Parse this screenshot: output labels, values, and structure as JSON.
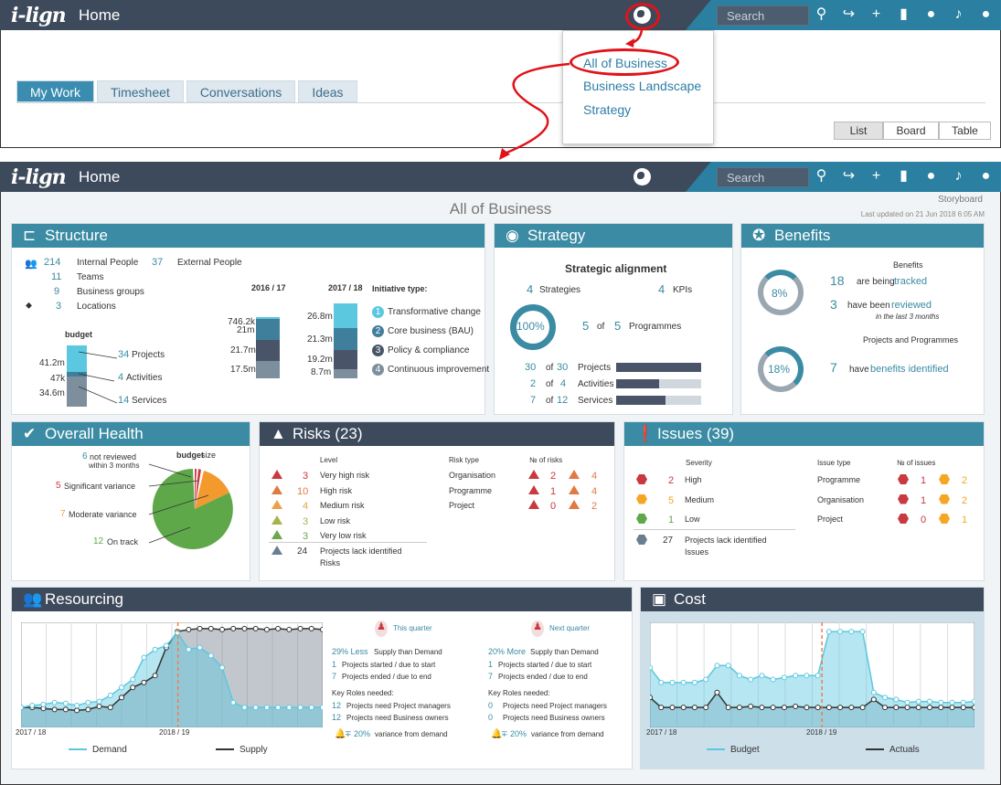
{
  "app": {
    "logo": "i-lign",
    "home": "Home",
    "search_placeholder": "Search"
  },
  "top": {
    "tabs": [
      {
        "label": "My Work",
        "active": true
      },
      {
        "label": "Timesheet"
      },
      {
        "label": "Conversations"
      },
      {
        "label": "Ideas"
      }
    ],
    "views": [
      "List",
      "Board",
      "Table"
    ],
    "dropdown": [
      "All of Business",
      "Business Landscape",
      "Strategy"
    ]
  },
  "page": {
    "title": "All of Business",
    "storyboard": "Storyboard",
    "updated": "Last updated on 21 Jun 2018 6:05 AM"
  },
  "structure": {
    "title": "Structure",
    "rows": [
      {
        "n": "214",
        "label": "Internal People",
        "n2": "37",
        "label2": "External People"
      },
      {
        "n": "11",
        "label": "Teams"
      },
      {
        "n": "9",
        "label": "Business groups"
      },
      {
        "n": "3",
        "label": "Locations"
      }
    ],
    "budget_label": "budget",
    "budget": [
      {
        "v": "41.2m",
        "n": "34",
        "label": "Projects"
      },
      {
        "v": "47k",
        "n": "4",
        "label": "Activities"
      },
      {
        "v": "34.6m",
        "n": "14",
        "label": "Services"
      }
    ],
    "year1": "2016 / 17",
    "year2": "2017 / 18",
    "y1vals": [
      "746.2k",
      "21m",
      "21.7m",
      "17.5m"
    ],
    "y2vals": [
      "26.8m",
      "21.3m",
      "19.2m",
      "8.7m"
    ],
    "init_title": "Initiative type:",
    "init": [
      {
        "n": "1",
        "label": "Transformative change",
        "color": "#5bc8df"
      },
      {
        "n": "2",
        "label": "Core business (BAU)",
        "color": "#3f7f9c"
      },
      {
        "n": "3",
        "label": "Policy & compliance",
        "color": "#4a5468"
      },
      {
        "n": "4",
        "label": "Continuous improvement",
        "color": "#7d8f9c"
      }
    ]
  },
  "strategy": {
    "title": "Strategy",
    "subtitle": "Strategic alignment",
    "strategies_n": "4",
    "strategies": "Strategies",
    "kpis_n": "4",
    "kpis": "KPIs",
    "pct": "100%",
    "prog_a": "5",
    "of": "of",
    "prog_b": "5",
    "programmes": "Programmes",
    "rows": [
      {
        "a": "30",
        "b": "30",
        "label": "Projects",
        "frac": 1.0
      },
      {
        "a": "2",
        "b": "4",
        "label": "Activities",
        "frac": 0.5
      },
      {
        "a": "7",
        "b": "12",
        "label": "Services",
        "frac": 0.58
      }
    ]
  },
  "benefits": {
    "title": "Benefits",
    "head1": "Benefits",
    "pct1": "8%",
    "n1": "18",
    "t1a": "are being",
    "t1b": "tracked",
    "n2": "3",
    "t2a": "have been",
    "t2b": "reviewed",
    "t2c": "in the last 3 months",
    "head2": "Projects and Programmes",
    "pct2": "18%",
    "n3": "7",
    "t3a": "have",
    "t3b": "benefits identified"
  },
  "health": {
    "title": "Overall Health",
    "size_a": "budget",
    "size_b": "size",
    "labels": [
      {
        "n": "6",
        "t": "not reviewed",
        "t2": "within 3 months"
      },
      {
        "n": "5",
        "t": "Significant variance"
      },
      {
        "n": "7",
        "t": "Moderate variance"
      },
      {
        "n": "12",
        "t": "On track"
      }
    ]
  },
  "risks": {
    "title": "Risks (23)",
    "level": "Level",
    "type": "Risk type",
    "count": "№ of risks",
    "levels": [
      {
        "n": "3",
        "t": "Very high risk",
        "c": "#c9393f"
      },
      {
        "n": "10",
        "t": "High risk",
        "c": "#e07a45"
      },
      {
        "n": "4",
        "t": "Medium risk",
        "c": "#e9a24a"
      },
      {
        "n": "3",
        "t": "Low risk",
        "c": "#a9b34b"
      },
      {
        "n": "3",
        "t": "Very low risk",
        "c": "#6aa84f"
      }
    ],
    "lack_n": "24",
    "lack": "Projects lack identified",
    "lack2": "Risks",
    "types": [
      {
        "t": "Organisation",
        "a": "2",
        "b": "4"
      },
      {
        "t": "Programme",
        "a": "1",
        "b": "4"
      },
      {
        "t": "Project",
        "a": "0",
        "b": "2"
      }
    ]
  },
  "issues": {
    "title": "Issues (39)",
    "severity": "Severity",
    "type": "Issue type",
    "count": "№ of issues",
    "levels": [
      {
        "n": "2",
        "t": "High",
        "c": "#c9393f"
      },
      {
        "n": "5",
        "t": "Medium",
        "c": "#f5a623"
      },
      {
        "n": "1",
        "t": "Low",
        "c": "#5fa84a"
      }
    ],
    "lack_n": "27",
    "lack": "Projects lack identified",
    "lack2": "Issues",
    "types": [
      {
        "t": "Programme",
        "a": "1",
        "b": "2"
      },
      {
        "t": "Organisation",
        "a": "1",
        "b": "2"
      },
      {
        "t": "Project",
        "a": "0",
        "b": "1"
      }
    ]
  },
  "resourcing": {
    "title": "Resourcing",
    "x1": "2017 / 18",
    "x2": "2018 / 19",
    "legend1": "Demand",
    "legend2": "Supply",
    "q1": {
      "title": "This quarter",
      "pct": "29% Less",
      "supply": "Supply than Demand",
      "a": "1",
      "at": "Projects started / due to start",
      "b": "7",
      "bt": "Projects ended / due to end",
      "roles": "Key Roles needed:",
      "c": "12",
      "ct": "Projects need Project managers",
      "d": "12",
      "dt": "Projects need Business owners",
      "v": "∓ 20%",
      "vt": "variance from demand"
    },
    "q2": {
      "title": "Next quarter",
      "pct": "20% More",
      "supply": "Supply than Demand",
      "a": "1",
      "at": "Projects started / due to start",
      "b": "7",
      "bt": "Projects ended / due to end",
      "roles": "Key Roles needed:",
      "c": "0",
      "ct": "Projects need Project managers",
      "d": "0",
      "dt": "Projects need Business owners",
      "v": "∓ 20%",
      "vt": "variance from demand"
    },
    "chart_data": {
      "type": "area",
      "series": [
        {
          "name": "Demand",
          "values": [
            20,
            22,
            23,
            25,
            24,
            22,
            25,
            26,
            32,
            40,
            48,
            70,
            78,
            82,
            95,
            78,
            80,
            72,
            60,
            25,
            20,
            20,
            20,
            20,
            20,
            20,
            20,
            20
          ]
        },
        {
          "name": "Supply",
          "values": [
            20,
            20,
            19,
            18,
            18,
            17,
            18,
            21,
            20,
            30,
            40,
            45,
            52,
            80,
            96,
            98,
            99,
            99,
            98,
            99,
            99,
            99,
            98,
            99,
            98,
            99,
            99,
            98
          ]
        }
      ],
      "ylim": [
        0,
        100
      ]
    }
  },
  "cost": {
    "title": "Cost",
    "x1": "2017 / 18",
    "x2": "2018 / 19",
    "legend1": "Budget",
    "legend2": "Actuals",
    "chart_data": {
      "type": "area",
      "series": [
        {
          "name": "Budget",
          "values": [
            60,
            45,
            45,
            45,
            45,
            48,
            62,
            62,
            52,
            48,
            52,
            48,
            50,
            52,
            52,
            52,
            96,
            96,
            96,
            96,
            35,
            30,
            28,
            25,
            26,
            26,
            25,
            25,
            25,
            26
          ]
        },
        {
          "name": "Actuals",
          "values": [
            30,
            20,
            20,
            20,
            20,
            20,
            35,
            20,
            20,
            21,
            20,
            20,
            20,
            21,
            20,
            20,
            20,
            20,
            20,
            20,
            28,
            20,
            20,
            20,
            20,
            20,
            20,
            20,
            20,
            20
          ]
        }
      ],
      "ylim": [
        0,
        100
      ]
    }
  }
}
